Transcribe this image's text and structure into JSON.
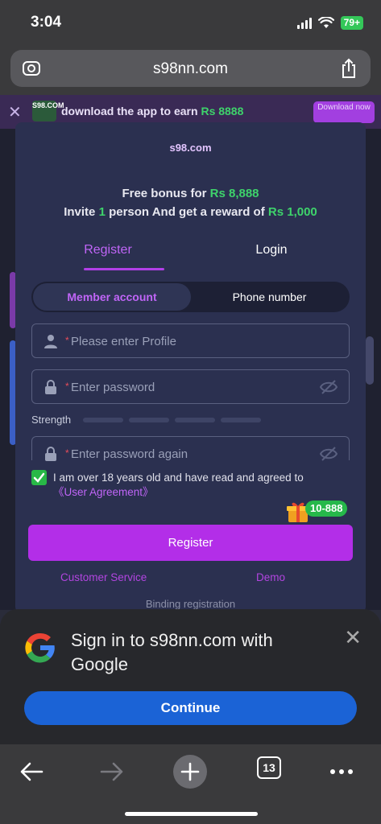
{
  "status_bar": {
    "time": "3:04",
    "battery": "79+"
  },
  "browser": {
    "url": "s98nn.com",
    "tab_count": "13"
  },
  "promo_banner": {
    "logo": "S98.COM",
    "text": "download the app to earn ",
    "amount": "Rs 8888",
    "button": "Download now"
  },
  "modal": {
    "logo": "s98.com",
    "bonus_line1_prefix": "Free bonus for ",
    "bonus_line1_amount": "Rs 8,888",
    "bonus_line2_a": "Invite ",
    "bonus_line2_count": "1",
    "bonus_line2_b": " person And get a reward of ",
    "bonus_line2_amount": "Rs 1,000",
    "tabs": {
      "register": "Register",
      "login": "Login"
    },
    "toggle": {
      "member": "Member account",
      "phone": "Phone number"
    },
    "fields": {
      "profile_placeholder": "Please enter Profile",
      "password_placeholder": "Enter password",
      "confirm_placeholder": "Enter password again",
      "required_mark": "*"
    },
    "strength_label": "Strength",
    "agreement_text": "I am over 18 years old and have read and agreed to ",
    "agreement_link": "《User Agreement》",
    "gift_badge": "10-888",
    "register_button": "Register",
    "customer_service": "Customer Service",
    "demo": "Demo",
    "binding": "Binding registration"
  },
  "google_sheet": {
    "title": "Sign in to s98nn.com with Google",
    "continue": "Continue"
  },
  "colors": {
    "accent": "#b32ee8",
    "green": "#3ed36b",
    "modal_bg": "#2b3050",
    "google_blue": "#1b63d6"
  }
}
